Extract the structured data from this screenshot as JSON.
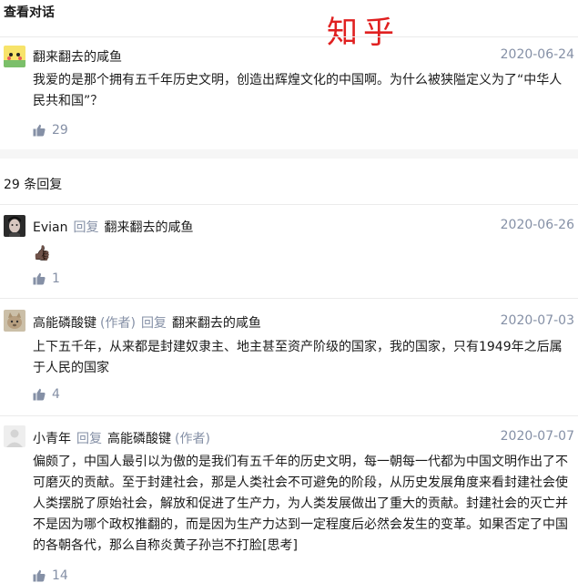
{
  "header": {
    "title": "查看对话",
    "watermark": "知乎"
  },
  "root_comment": {
    "author": "翻来翻去的咸鱼",
    "date": "2020-06-24",
    "content": "我爱的是那个拥有五千年历史文明，创造出辉煌文化的中国啊。为什么被狭隘定义为了“中华人民共和国”？",
    "likes": "29"
  },
  "replies_count": "29 条回复",
  "reply_word": "回复",
  "replies": [
    {
      "author": "Evian",
      "reply_to": "翻来翻去的咸鱼",
      "date": "2020-06-26",
      "content": "👍🏿",
      "likes": "1"
    },
    {
      "author": "高能磷酸键",
      "author_tag": "(作者)",
      "reply_to": "翻来翻去的咸鱼",
      "date": "2020-07-03",
      "content": "上下五千年，从来都是封建奴隶主、地主甚至资产阶级的国家，我的国家，只有1949年之后属于人民的国家",
      "likes": "4"
    },
    {
      "author": "小青年",
      "reply_to": "高能磷酸键",
      "reply_to_tag": "(作者)",
      "date": "2020-07-07",
      "content": "偏颇了，中国人最引以为傲的是我们有五千年的历史文明，每一朝每一代都为中国文明作出了不可磨灭的贡献。至于封建社会，那是人类社会不可避免的阶段，从历史发展角度来看封建社会使人类摆脱了原始社会，解放和促进了生产力，为人类发展做出了重大的贡献。封建社会的灭亡并不是因为哪个政权推翻的，而是因为生产力达到一定程度后必然会发生的变革。如果否定了中国的各朝各代，那么自称炎黄子孙岂不打脸[思考]",
      "likes": "14"
    }
  ],
  "colors": {
    "meta_gray": "#8590a6",
    "watermark_red": "#e02020",
    "divider": "#ebebeb"
  }
}
